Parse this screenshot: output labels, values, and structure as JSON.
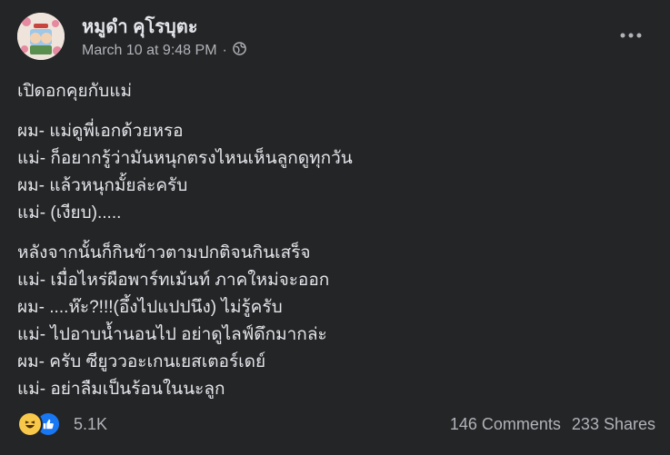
{
  "post": {
    "author": "หมูดำ คุโรบุตะ",
    "timestamp": "March 10 at 9:48 PM",
    "separator": "·",
    "privacy_icon": "globe-icon",
    "more_icon": "more-options-icon",
    "paragraphs": [
      [
        "เปิดอกคุยกับแม่"
      ],
      [
        "ผม- แม่ดูพี่เอกด้วยหรอ",
        "แม่- ก็อยากรู้ว่ามันหนุกตรงไหนเห็นลูกดูทุกวัน",
        "ผม- แล้วหนุกมั้ยล่ะครับ",
        "แม่- (เงียบ)....."
      ],
      [
        "หลังจากนั้นก็กินข้าวตามปกติจนกินเสร็จ",
        "แม่- เมื่อไหร่ผือพาร์ทเม้นท์ ภาคใหม่จะออก",
        "ผม- ....ห๊ะ?!!!(อึ้งไปแปปนึง) ไม่รู้ครับ",
        "แม่- ไปอาบน้ำนอนไป อย่าดูไลฟ์ดึกมากล่ะ",
        "ผม- ครับ ซียูววอะเกนเยสเตอร์เดย์",
        "แม่- อย่าลืมเป็นร้อนในนะลูก"
      ]
    ]
  },
  "footer": {
    "reactions": [
      "haha-icon",
      "like-icon"
    ],
    "reaction_count": "5.1K",
    "comments": "146 Comments",
    "shares": "233 Shares"
  },
  "colors": {
    "background": "#242526",
    "text_primary": "#e4e6eb",
    "text_secondary": "#b0b3b8",
    "like_blue": "#1877f2",
    "haha_yellow": "#f7c84a"
  }
}
